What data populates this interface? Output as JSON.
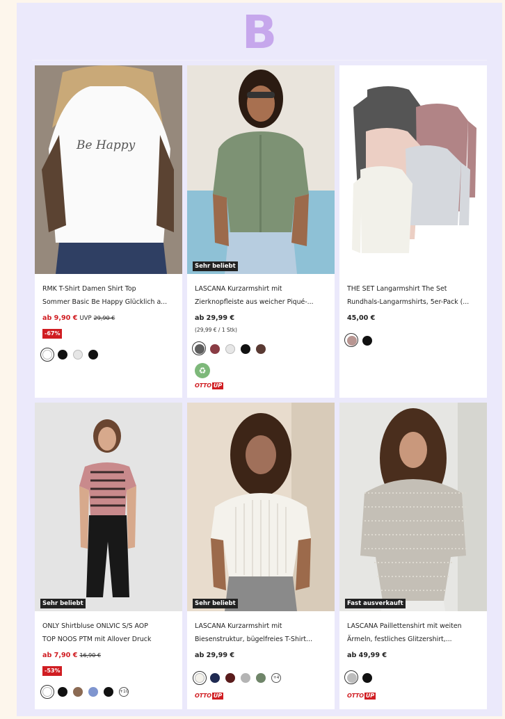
{
  "header": {
    "letter": "B"
  },
  "products": [
    {
      "title_line1": "RMK T-Shirt Damen Shirt Top",
      "title_line2": "Sommer Basic Be Happy Glücklich a...",
      "price_main": "ab 9,90 €",
      "price_uvp_label": "UVP",
      "price_old": "29,90 €",
      "discount": "-67%",
      "image_text": "Be Happy",
      "swatches": [
        "#ffffff",
        "#111111",
        "#e6e6e6",
        "#111111"
      ],
      "selected_swatch": 0
    },
    {
      "flag": "Sehr beliebt",
      "title_line1": "LASCANA Kurzarmshirt mit",
      "title_line2": "Zierknopfleiste aus weicher Piqué-...",
      "price_main": "ab 29,99 €",
      "unit_price": "(29,99 € / 1 Stk)",
      "swatches": [
        "#5e5e5e",
        "#8a3c44",
        "#e6e6e6",
        "#111111",
        "#5a3a33"
      ],
      "selected_swatch": 0,
      "eco_icon": "sustainability-icon",
      "otto_brand": "OTTO",
      "otto_badge": "UP"
    },
    {
      "title_line1": "THE SET Langarmshirt The Set",
      "title_line2": "Rundhals-Langarmshirts, 5er-Pack (...",
      "price_main": "45,00 €",
      "swatches": [
        "#b89692",
        "#111111"
      ],
      "selected_swatch": 0
    },
    {
      "flag": "Sehr beliebt",
      "title_line1": "ONLY Shirtbluse ONLVIC S/S AOP",
      "title_line2": "TOP NOOS PTM mit Allover Druck",
      "price_main": "ab 7,90 €",
      "price_old": "16,90 €",
      "discount": "-53%",
      "swatches": [
        "#ffffff",
        "#111111",
        "#8b6a53",
        "#7f95cf",
        "#111111"
      ],
      "selected_swatch": 0,
      "more_label": "+10"
    },
    {
      "flag": "Sehr beliebt",
      "title_line1": "LASCANA Kurzarmshirt mit",
      "title_line2": "Biesenstruktur, bügelfreies T-Shirt...",
      "price_main": "ab 29,99 €",
      "swatches": [
        "#f3f1ea",
        "#1f2a52",
        "#5a1c1c",
        "#b4b4b4",
        "#6f8569"
      ],
      "selected_swatch": 0,
      "more_label": "+4",
      "otto_brand": "OTTO",
      "otto_badge": "UP"
    },
    {
      "flag": "Fast ausverkauft",
      "title_line1": "LASCANA Paillettenshirt mit weiten",
      "title_line2": "Ärmeln, festliches Glitzershirt,...",
      "price_main": "ab 49,99 €",
      "swatches": [
        "#bdbdbd",
        "#111111"
      ],
      "selected_swatch": 0,
      "otto_brand": "OTTO",
      "otto_badge": "UP"
    }
  ]
}
